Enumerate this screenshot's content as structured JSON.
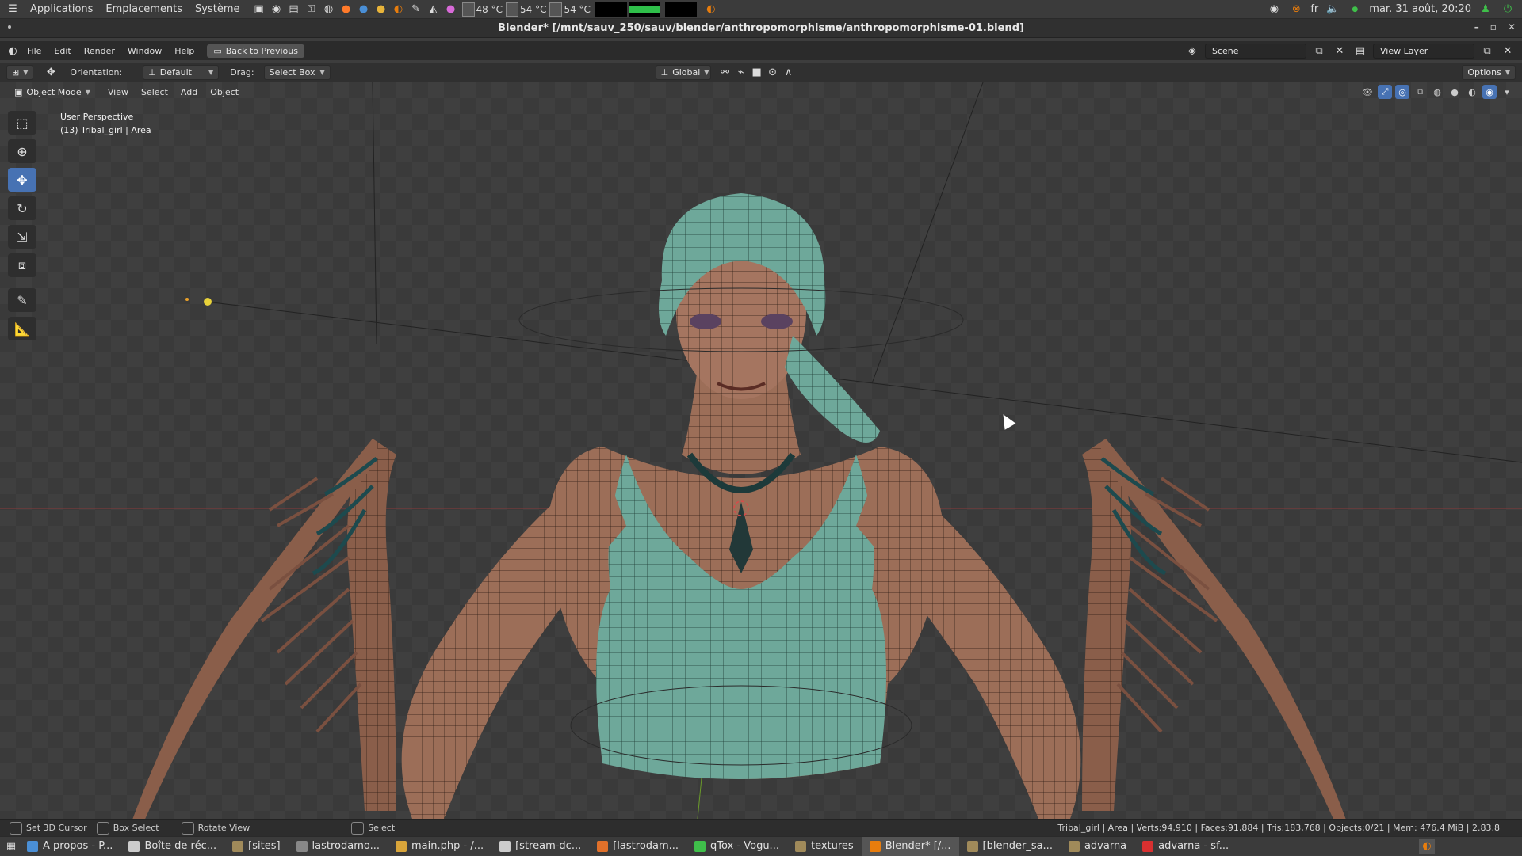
{
  "os_panel": {
    "menus": [
      "Applications",
      "Emplacements",
      "Système"
    ],
    "temps": [
      "48 °C",
      "54 °C",
      "54 °C"
    ],
    "language": "fr",
    "datetime": "mar. 31 août, 20:20"
  },
  "window": {
    "title": "Blender* [/mnt/sauv_250/sauv/blender/anthropomorphisme/anthropomorphisme-01.blend]"
  },
  "blender_menu": {
    "items": [
      "File",
      "Edit",
      "Render",
      "Window",
      "Help"
    ],
    "back_button": "Back to Previous",
    "scene_label": "Scene",
    "view_layer_label": "View Layer"
  },
  "tool_header": {
    "orientation_label": "Orientation:",
    "orientation_value": "Default",
    "drag_label": "Drag:",
    "drag_value": "Select Box",
    "transform_orientation": "Global",
    "options_label": "Options"
  },
  "viewport_header": {
    "mode": "Object Mode",
    "menus": [
      "View",
      "Select",
      "Add",
      "Object"
    ]
  },
  "viewport": {
    "perspective": "User Perspective",
    "object_info": "(13) Tribal_girl | Area"
  },
  "status_bar": {
    "hints": [
      "Set 3D Cursor",
      "Box Select",
      "Rotate View",
      "Select"
    ],
    "stats": "Tribal_girl | Area | Verts:94,910 | Faces:91,884 | Tris:183,768 | Objects:0/21 | Mem: 476.4 MiB | 2.83.8"
  },
  "taskbar": {
    "tasks": [
      {
        "label": "A propos - P...",
        "color": "#4a8fd6"
      },
      {
        "label": "Boîte de réc...",
        "color": "#cccccc"
      },
      {
        "label": "[sites]",
        "color": "#a08a5a"
      },
      {
        "label": "lastrodamo...",
        "color": "#888888"
      },
      {
        "label": "main.php - /...",
        "color": "#d9a53a"
      },
      {
        "label": "[stream-dc...",
        "color": "#cccccc"
      },
      {
        "label": "[lastrodam...",
        "color": "#e0702a"
      },
      {
        "label": "qTox - Vogu...",
        "color": "#3fbf4a"
      },
      {
        "label": "textures",
        "color": "#a08a5a"
      },
      {
        "label": "Blender* [/...",
        "color": "#e87d0d"
      },
      {
        "label": "[blender_sa...",
        "color": "#a08a5a"
      },
      {
        "label": "advarna",
        "color": "#a08a5a"
      },
      {
        "label": "advarna - sf...",
        "color": "#d83030"
      }
    ]
  }
}
